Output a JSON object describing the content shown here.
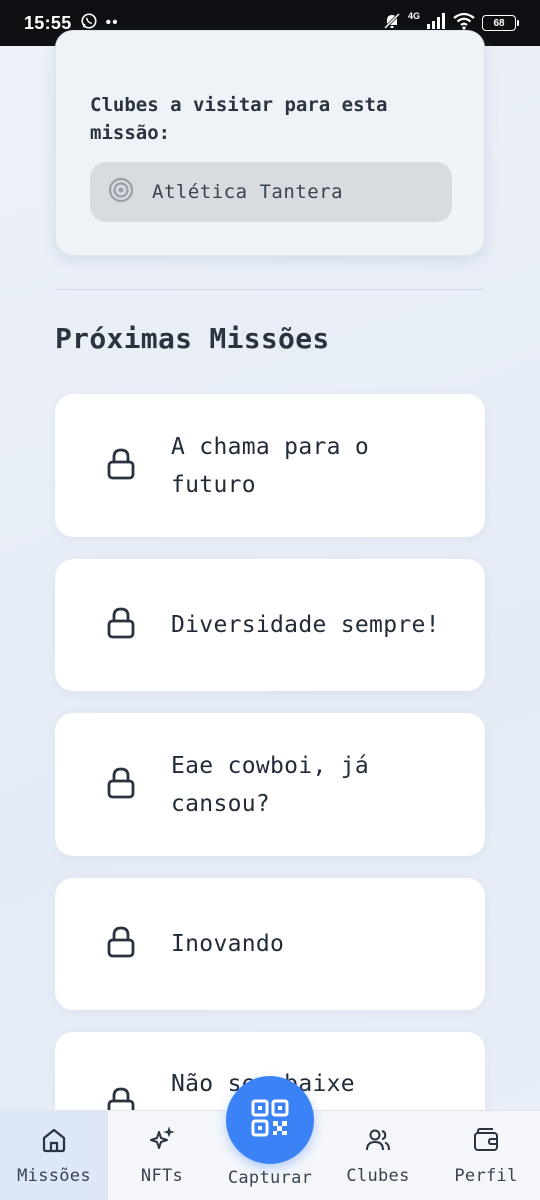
{
  "status_bar": {
    "time": "15:55",
    "dots": "••",
    "network": "4G",
    "battery": "68"
  },
  "mission": {
    "clubs_label": "Clubes a visitar para esta missão:",
    "clubs": [
      {
        "label": "Atlética Tantera",
        "icon": "target-icon"
      }
    ]
  },
  "next_missions": {
    "title": "Próximas Missões",
    "items": [
      {
        "title": "A chama para o futuro",
        "icon": "lock-icon"
      },
      {
        "title": "Diversidade sempre!",
        "icon": "lock-icon"
      },
      {
        "title": "Eae cowboi, já cansou?",
        "icon": "lock-icon"
      },
      {
        "title": "Inovando",
        "icon": "lock-icon"
      },
      {
        "title": "Não se abaixe",
        "icon": "lock-icon"
      }
    ]
  },
  "bottom_nav": {
    "items": [
      {
        "label": "Missões",
        "icon": "home-icon",
        "active": true
      },
      {
        "label": "NFTs",
        "icon": "sparkles-icon",
        "active": false
      },
      {
        "label": "Capturar",
        "icon": "qr-code-icon",
        "active": false
      },
      {
        "label": "Clubes",
        "icon": "users-icon",
        "active": false
      },
      {
        "label": "Perfil",
        "icon": "wallet-icon",
        "active": false
      }
    ]
  },
  "colors": {
    "accent": "#3b82f6",
    "background": "#e8eef7",
    "card": "#ffffff",
    "text": "#222b38"
  }
}
